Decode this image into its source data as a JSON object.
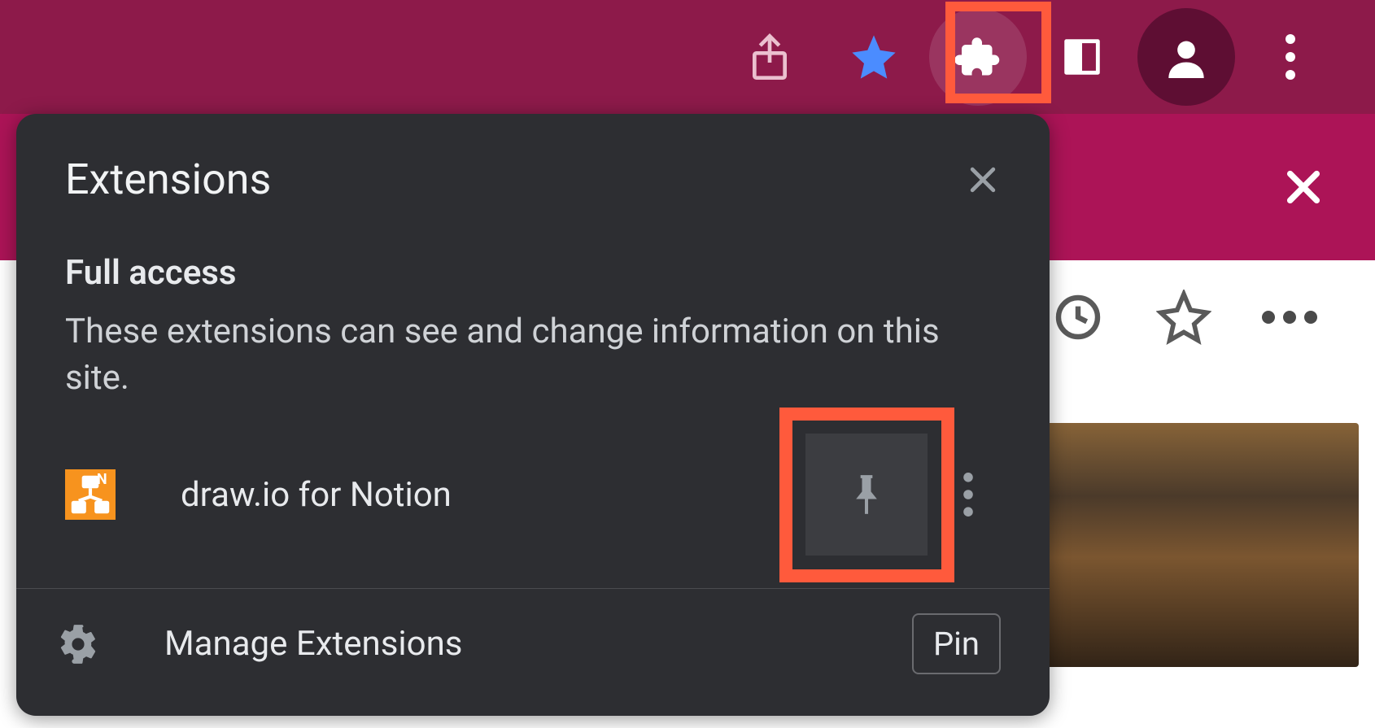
{
  "toolbar": {
    "share_icon": "share",
    "star_icon": "star",
    "extensions_icon": "puzzle",
    "reader_icon": "reader",
    "profile_icon": "profile",
    "menu_icon": "menu"
  },
  "second_bar": {
    "close_icon": "close"
  },
  "page_toolbar": {
    "history_icon": "clock",
    "favorite_icon": "star-outline",
    "more_icon": "more"
  },
  "popup": {
    "title": "Extensions",
    "close_icon": "close",
    "section_heading": "Full access",
    "section_desc": "These extensions can see and change information on this site.",
    "extension": {
      "name": "draw.io for Notion",
      "icon_name": "drawio-icon",
      "pin_icon": "pin",
      "more_icon": "more-vertical"
    },
    "manage_label": "Manage Extensions",
    "gear_icon": "gear",
    "pin_tooltip": "Pin"
  },
  "highlights": {
    "extensions_button": true,
    "pin_button": true
  }
}
